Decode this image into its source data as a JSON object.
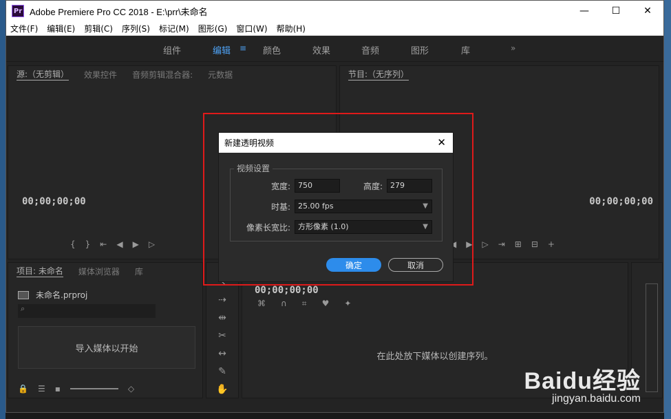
{
  "window": {
    "title": "Adobe Premiere Pro CC 2018 - E:\\prr\\未命名",
    "app_icon": "Pr",
    "controls": {
      "minimize": "—",
      "maximize": "☐",
      "close": "✕"
    }
  },
  "menu": [
    "文件(F)",
    "编辑(E)",
    "剪辑(C)",
    "序列(S)",
    "标记(M)",
    "图形(G)",
    "窗口(W)",
    "帮助(H)"
  ],
  "workspaces": {
    "tabs": [
      "组件",
      "编辑",
      "颜色",
      "效果",
      "音频",
      "图形",
      "库"
    ],
    "active": "编辑",
    "menu_icon": "≡",
    "more": "»"
  },
  "source_panel": {
    "tabs": [
      "源:（无剪辑）",
      "效果控件",
      "音频剪辑混合器:",
      "元数据"
    ],
    "timecode": "00;00;00;00"
  },
  "program_panel": {
    "tab": "节目:（无序列）",
    "timecode": "00;00;00;00"
  },
  "project_panel": {
    "tabs": [
      "项目: 未命名",
      "媒体浏览器",
      "库"
    ],
    "file": "未命名.prproj",
    "import_text": "导入媒体以开始"
  },
  "timeline_panel": {
    "timecode": "00;00;00;00",
    "drop_text": "在此处放下媒体以创建序列。"
  },
  "dialog": {
    "title": "新建透明视频",
    "group_label": "视频设置",
    "width_label": "宽度:",
    "width_value": "750",
    "height_label": "高度:",
    "height_value": "279",
    "timebase_label": "时基:",
    "timebase_value": "25.00 fps",
    "pixel_aspect_label": "像素长宽比:",
    "pixel_aspect_value": "方形像素 (1.0)",
    "ok_label": "确定",
    "cancel_label": "取消",
    "close_icon": "✕"
  },
  "watermark": {
    "brand": "Baidu经验",
    "url": "jingyan.baidu.com"
  },
  "colors": {
    "accent": "#2d8ceb",
    "highlight_box": "#e01a1a",
    "workspace_active": "#4ea1f3"
  }
}
